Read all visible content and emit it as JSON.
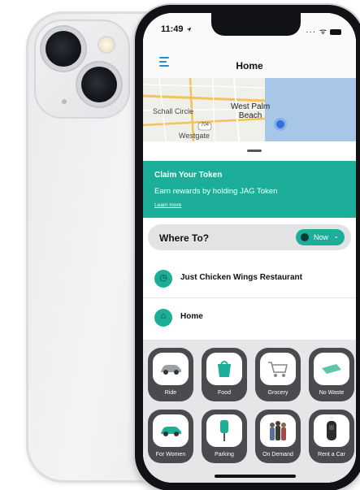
{
  "status": {
    "time": "11:49",
    "location_arrow": "location-arrow-icon",
    "indicators": "··· ᯤ"
  },
  "nav": {
    "title": "Home",
    "menu_icon": "hamburger-menu-icon"
  },
  "map": {
    "labels": [
      "Schall Circle",
      "Westgate"
    ],
    "city_line1": "West Palm",
    "city_line2": "Beach",
    "route_badge": "704"
  },
  "token_banner": {
    "title": "Claim Your Token",
    "text": "Earn rewards by holding JAG Token",
    "link": "Learn more"
  },
  "where_to": {
    "label": "Where To?",
    "time_option": "Now"
  },
  "recent": [
    {
      "icon": "clock-icon",
      "label": "Just Chicken Wings Restaurant"
    },
    {
      "icon": "home-icon",
      "label": "Home"
    }
  ],
  "services": [
    {
      "label": "Ride",
      "icon": "car-icon"
    },
    {
      "label": "Food",
      "icon": "food-bag-icon"
    },
    {
      "label": "Grocery",
      "icon": "shopping-cart-icon"
    },
    {
      "label": "No Waste",
      "icon": "ticket-icon"
    },
    {
      "label": "For Women",
      "icon": "teal-car-icon"
    },
    {
      "label": "Parking",
      "icon": "parking-meter-icon"
    },
    {
      "label": "On Demand",
      "icon": "people-group-icon"
    },
    {
      "label": "Rent a Car",
      "icon": "car-key-icon"
    }
  ],
  "colors": {
    "brand_teal": "#1cae98",
    "tile_dark": "#4b4b4f",
    "menu_blue": "#1f8fd8"
  }
}
